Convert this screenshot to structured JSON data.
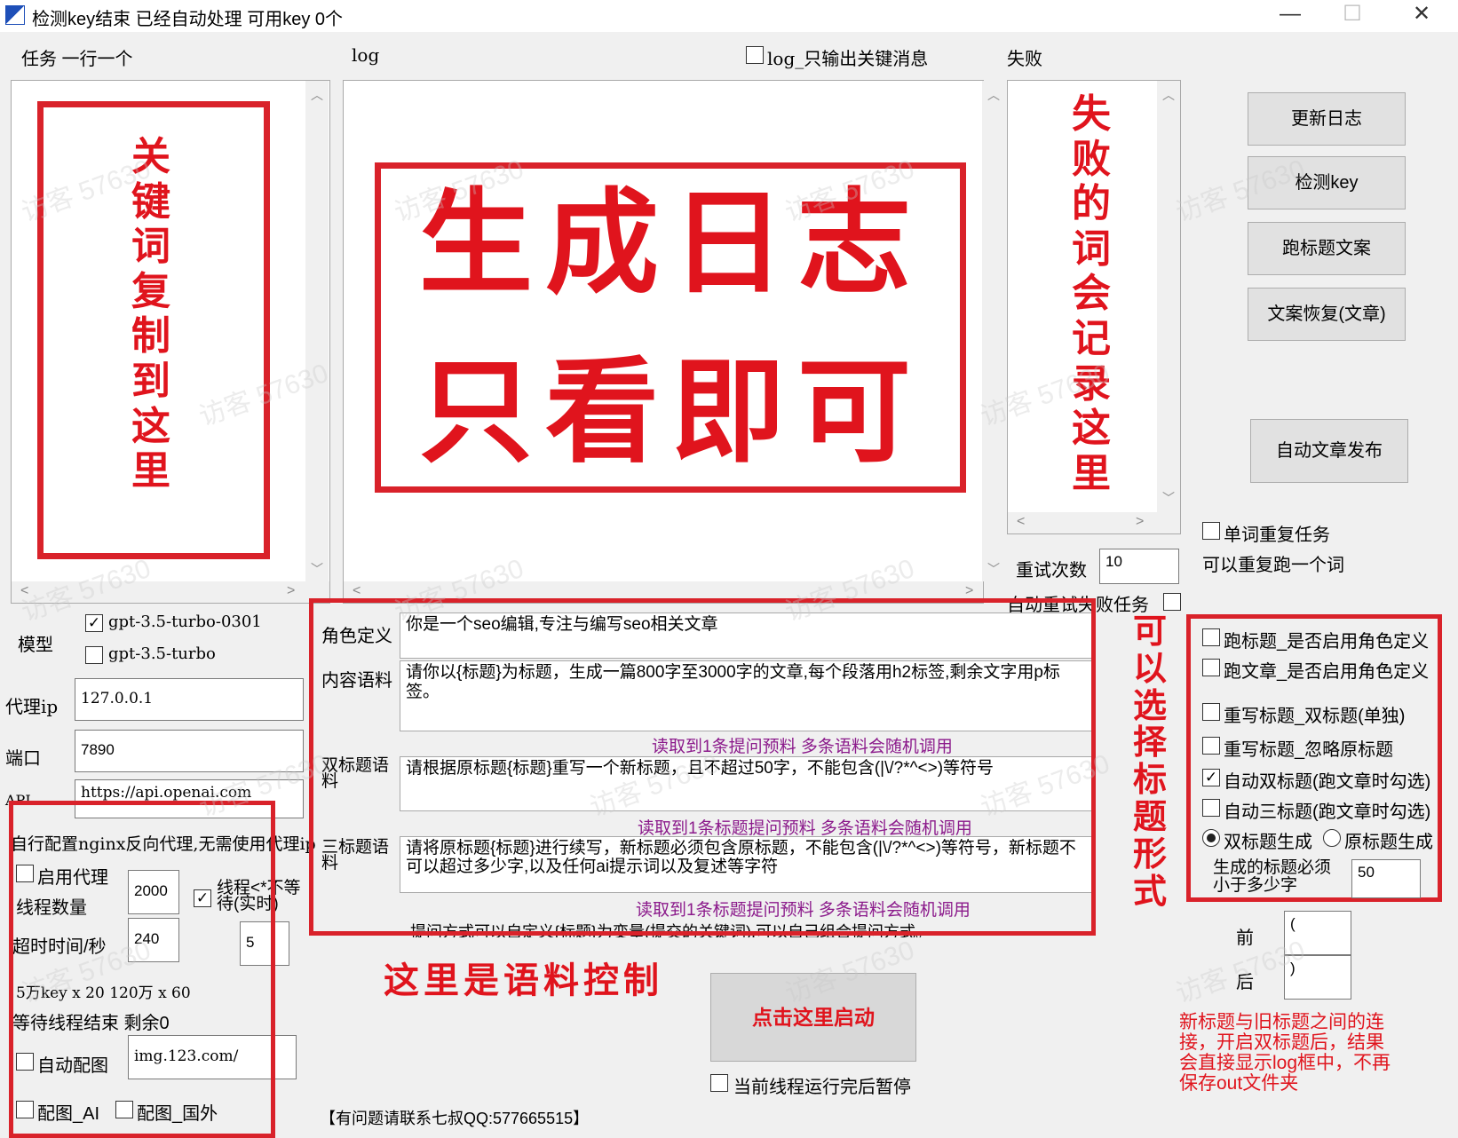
{
  "window": {
    "title": "检测key结束  已经自动处理 可用key 0个",
    "minimize": "—",
    "maximize": "☐",
    "close": "✕"
  },
  "headers": {
    "tasks": "任务 一行一个",
    "log": "log",
    "log_key_only": "log_只输出关键消息",
    "fail": "失败"
  },
  "annotations": {
    "keywords": "关键词复制到这里",
    "log_line1": "生成日志",
    "log_line2": "只看即可",
    "fail": "失败的词会记录这里",
    "title_form": "可以选择标题形式",
    "corpus": "这里是语料控制",
    "link_note": "新标题与旧标题之间的连接，开启双标题后，结果会直接显示log框中，不再保存out文件夹"
  },
  "right_buttons": {
    "update_log": "更新日志",
    "check_key": "检测key",
    "run_title": "跑标题文案",
    "restore": "文案恢复(文章)",
    "auto_publish": "自动文章发布"
  },
  "retry": {
    "label": "重试次数",
    "value": "10",
    "auto_retry": "自动重试失败任务"
  },
  "word_repeat": {
    "label": "单词重复任务",
    "desc": "可以重复跑一个词"
  },
  "model": {
    "label": "模型",
    "options": [
      {
        "name": "gpt-3.5-turbo-0301",
        "checked": true
      },
      {
        "name": "gpt-3.5-turbo",
        "checked": false
      }
    ]
  },
  "proxy": {
    "ip_label": "代理ip",
    "ip_value": "127.0.0.1",
    "port_label": "端口",
    "port_value": "7890",
    "api_label": "API",
    "api_value": "https://api.openai.com"
  },
  "nginx_note": "自行配置nginx反向代理,无需使用代理ip",
  "threads": {
    "enable_proxy": "启用代理",
    "thread_label": "线程数量",
    "thread_value": "2000",
    "wait_label": "线程<*不等待(实时)",
    "wait_checked": true,
    "wait_value": "5",
    "timeout_label": "超时时间/秒",
    "timeout_value": "240",
    "key_info": "5万key x 20  120万 x 60",
    "remaining": "等待线程结束 剩余0"
  },
  "image": {
    "auto_label": "自动配图",
    "auto_value": "img.123.com/",
    "ai_label": "配图_AI",
    "foreign_label": "配图_国外"
  },
  "corpus": {
    "role_label": "角色定义",
    "role_value": "你是一个seo编辑,专注与编写seo相关文章",
    "content_label": "内容语料",
    "content_value": "请你以{标题}为标题，生成一篇800字至3000字的文章,每个段落用h2标签,剩余文字用p标签。",
    "content_info": "读取到1条提问预料   多条语料会随机调用",
    "double_label": "双标题语料",
    "double_value": "请根据原标题{标题}重写一个新标题，且不超过50字，不能包含(|\\/?*^<>)等符号",
    "double_info": "读取到1条标题提问预料   多条语料会随机调用",
    "triple_label": "三标题语料",
    "triple_value": "请将原标题{标题}进行续写，新标题必须包含原标题，不能包含(|\\/?*^<>)等符号，新标题不可以超过多少字,以及任何ai提示词以及复述等字符",
    "triple_info": "读取到1条标题提问预料   多条语料会随机调用",
    "tip": "提问方式可以自定义{标题}为变量(提交的关键词),可以自己组合提问方式。"
  },
  "title_options": {
    "opt1": "跑标题_是否启用角色定义",
    "opt2": "跑文章_是否启用角色定义",
    "opt3": "重写标题_双标题(单独)",
    "opt4": "重写标题_忽略原标题",
    "opt5": "自动双标题(跑文章时勾选)",
    "opt6": "自动三标题(跑文章时勾选)",
    "radio1": "双标题生成",
    "radio2": "原标题生成",
    "max_label": "生成的标题必须小于多少字",
    "max_value": "50"
  },
  "connector": {
    "before_label": "前",
    "before_value": "(",
    "after_label": "后",
    "after_value": ")"
  },
  "start": {
    "label": "点击这里启动",
    "pause_label": "当前线程运行完后暂停"
  },
  "contact": "【有问题请联系七叔QQ:577665515】",
  "watermark": "访客 57630"
}
